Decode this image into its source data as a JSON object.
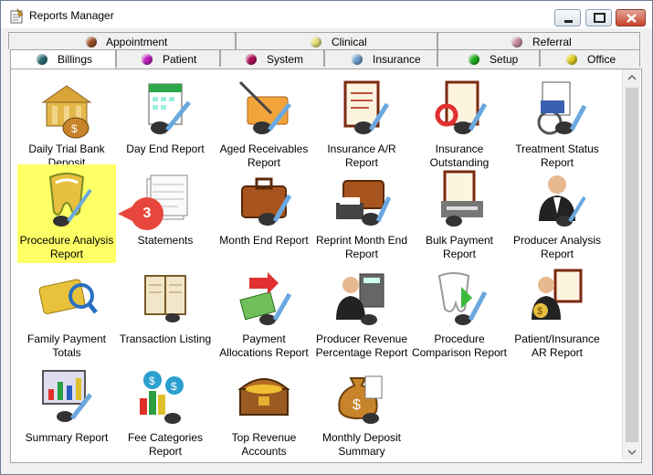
{
  "window": {
    "title": "Reports Manager"
  },
  "tabs_top": [
    {
      "label": "Appointment",
      "color": "#a0522d"
    },
    {
      "label": "Clinical",
      "color": "#e6e07a"
    },
    {
      "label": "Referral",
      "color": "#c88fa0"
    }
  ],
  "tabs_bottom": [
    {
      "label": "Billings",
      "color": "#2e6f7a"
    },
    {
      "label": "Patient",
      "color": "#c020c0"
    },
    {
      "label": "System",
      "color": "#b0105a"
    },
    {
      "label": "Insurance",
      "color": "#6fa0d0"
    },
    {
      "label": "Setup",
      "color": "#20b020"
    },
    {
      "label": "Office",
      "color": "#e0d020"
    }
  ],
  "active_tab": "Billings",
  "reports": [
    {
      "label": "Daily Trial Bank Deposit",
      "icon": "bank-deposit-icon"
    },
    {
      "label": "Day End Report",
      "icon": "calendar-report-icon"
    },
    {
      "label": "Aged Receivables Report",
      "icon": "folder-pen-icon"
    },
    {
      "label": "Insurance A/R Report",
      "icon": "document-frame-icon"
    },
    {
      "label": "Insurance Outstanding",
      "icon": "lifebuoy-document-icon"
    },
    {
      "label": "Treatment Status Report",
      "icon": "wheelchair-icon"
    },
    {
      "label": "Procedure Analysis Report",
      "icon": "tooth-report-icon"
    },
    {
      "label": "Statements",
      "icon": "envelope-stack-icon"
    },
    {
      "label": "Month End Report",
      "icon": "briefcase-icon"
    },
    {
      "label": "Reprint Month End Report",
      "icon": "briefcase-printer-icon"
    },
    {
      "label": "Bulk Payment Report",
      "icon": "printer-document-icon"
    },
    {
      "label": "Producer Analysis Report",
      "icon": "producer-icon"
    },
    {
      "label": "Family Payment Totals",
      "icon": "credit-card-icon"
    },
    {
      "label": "Transaction Listing",
      "icon": "notebook-icon"
    },
    {
      "label": "Payment Allocations Report",
      "icon": "cash-allocation-icon"
    },
    {
      "label": "Producer Revenue Percentage Report",
      "icon": "calculator-person-icon"
    },
    {
      "label": "Procedure Comparison Report",
      "icon": "tooth-comparison-icon"
    },
    {
      "label": "Patient/Insurance AR Report",
      "icon": "patient-insurance-icon"
    },
    {
      "label": "Summary Report",
      "icon": "monitor-chart-icon"
    },
    {
      "label": "Fee Categories Report",
      "icon": "fee-categories-icon"
    },
    {
      "label": "Top Revenue Accounts",
      "icon": "treasure-chest-icon"
    },
    {
      "label": "Monthly Deposit Summary",
      "icon": "money-bag-icon"
    }
  ],
  "highlighted_report": "Procedure Analysis Report",
  "callout": {
    "number": "3",
    "color": "#e8463c"
  },
  "colors": {
    "highlight": "#ffff66",
    "accent": "#e8463c"
  }
}
